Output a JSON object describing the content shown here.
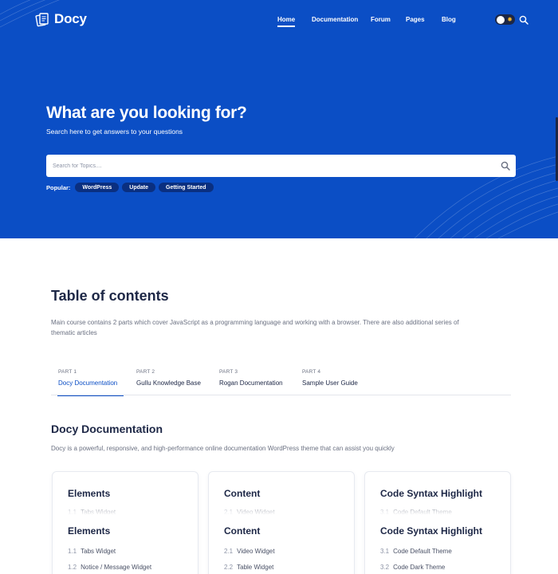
{
  "brand": {
    "name": "Docy"
  },
  "nav": {
    "items": [
      "Home",
      "Documentation",
      "Forum",
      "Pages",
      "Blog"
    ],
    "active": "Home"
  },
  "hero": {
    "title": "What are you looking for?",
    "subtitle": "Search here to get answers to your questions",
    "search_placeholder": "Search for Topics....",
    "popular_label": "Popular:",
    "popular_tags": [
      "WordPress",
      "Update",
      "Getting Started"
    ]
  },
  "toc": {
    "title": "Table of contents",
    "description": "Main course contains 2 parts which cover JavaScript as a programming language and working with a browser. There are also additional series of thematic articles",
    "tabs": [
      {
        "part": "PART 1",
        "label": "Docy Documentation"
      },
      {
        "part": "PART 2",
        "label": "Gullu Knowledge Base"
      },
      {
        "part": "PART 3",
        "label": "Rogan Documentation"
      },
      {
        "part": "PART 4",
        "label": "Sample User Guide"
      }
    ],
    "active_tab": 0
  },
  "docs": {
    "title": "Docy Documentation",
    "description": "Docy is a powerful, responsive, and high-performance online documentation WordPress theme that can assist you quickly",
    "cards": [
      {
        "title": "Elements",
        "items": [
          {
            "num": "1.1",
            "label": "Tabs Widget"
          },
          {
            "num": "1.2",
            "label": "Notice / Message Widget"
          }
        ]
      },
      {
        "title": "Content",
        "items": [
          {
            "num": "2.1",
            "label": "Video Widget"
          },
          {
            "num": "2.2",
            "label": "Table Widget"
          }
        ]
      },
      {
        "title": "Code Syntax Highlight",
        "items": [
          {
            "num": "3.1",
            "label": "Code Default Theme"
          },
          {
            "num": "3.2",
            "label": "Code Dark Theme"
          }
        ]
      }
    ]
  },
  "colors": {
    "hero_bg": "#0b4ec5",
    "tag_bg": "#0a2f80",
    "heading": "#1d2746",
    "accent": "#0b4ec5"
  }
}
